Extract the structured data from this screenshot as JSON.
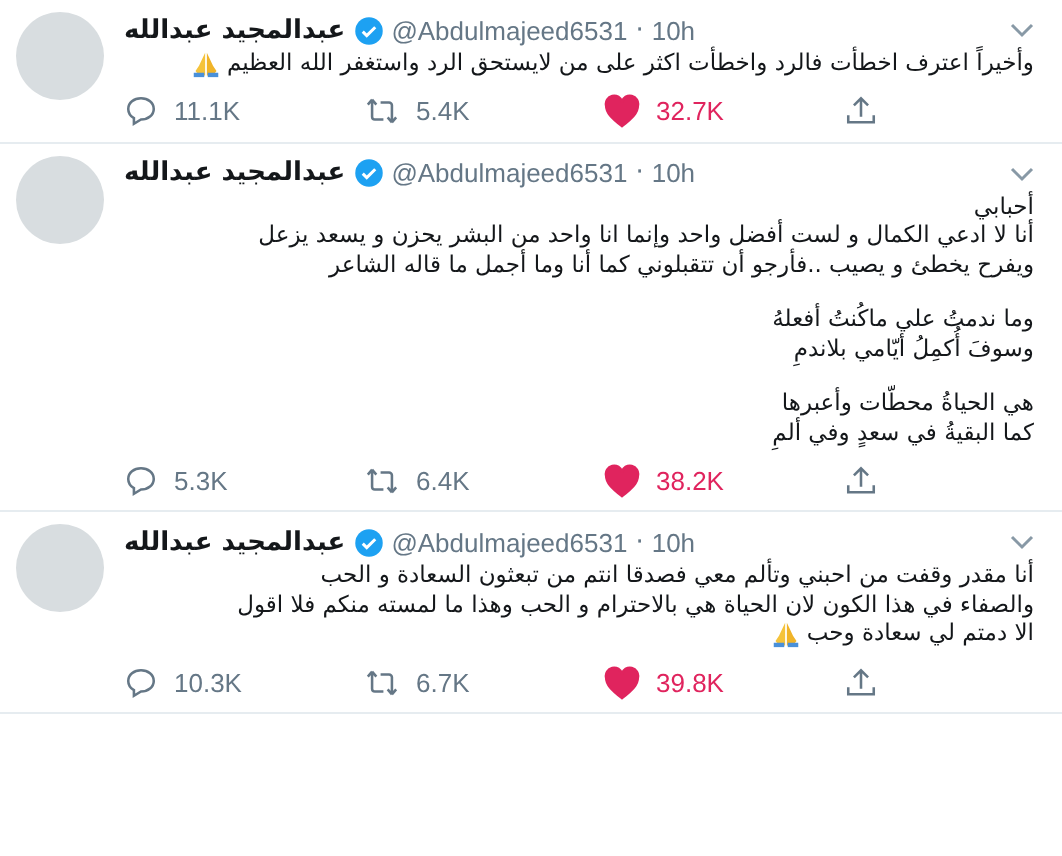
{
  "tweets": [
    {
      "name": "عبدالمجيد عبدالله",
      "verified": true,
      "handle": "@Abdulmajeed6531",
      "separator": "·",
      "time": "10h",
      "paragraphs": [
        [
          "وأخيراً اعترف اخطأت فالرد واخطأت اكثر على من لايستحق الرد واستغفر الله العظيم"
        ]
      ],
      "pray_emoji": true,
      "replies": "11.1K",
      "retweets": "5.4K",
      "likes": "32.7K",
      "liked": true
    },
    {
      "name": "عبدالمجيد عبدالله",
      "verified": true,
      "handle": "@Abdulmajeed6531",
      "separator": "·",
      "time": "10h",
      "paragraphs": [
        [
          "أحبابي",
          "أنا لا ادعي الكمال و لست أفضل واحد وإنما انا واحد من البشر يحزن و يسعد يزعل",
          "ويفرح يخطئ و يصيب ..فأرجو أن تتقبلوني كما أنا وما أجمل ما قاله الشاعر"
        ],
        [
          "وما ندمتُ علي ماكُنتُ أفعلهُ",
          "وسوفَ أُكمِلُ أيّامي بلاندمِ"
        ],
        [
          "هي الحياةُ محطّات وأعبرها",
          "كما البقيةُ في سعدٍ وفي ألمِ"
        ]
      ],
      "pray_emoji": false,
      "replies": "5.3K",
      "retweets": "6.4K",
      "likes": "38.2K",
      "liked": true
    },
    {
      "name": "عبدالمجيد عبدالله",
      "verified": true,
      "handle": "@Abdulmajeed6531",
      "separator": "·",
      "time": "10h",
      "paragraphs": [
        [
          "أنا مقدر وقفت من احبني وتألم معي فصدقا انتم من تبعثون السعادة و الحب",
          "والصفاء في هذا الكون لان الحياة هي بالاحترام و الحب وهذا ما لمسته منكم فلا اقول",
          "الا دمتم لي سعادة وحب"
        ]
      ],
      "pray_emoji": true,
      "replies": "10.3K",
      "retweets": "6.7K",
      "likes": "39.8K",
      "liked": true
    }
  ]
}
